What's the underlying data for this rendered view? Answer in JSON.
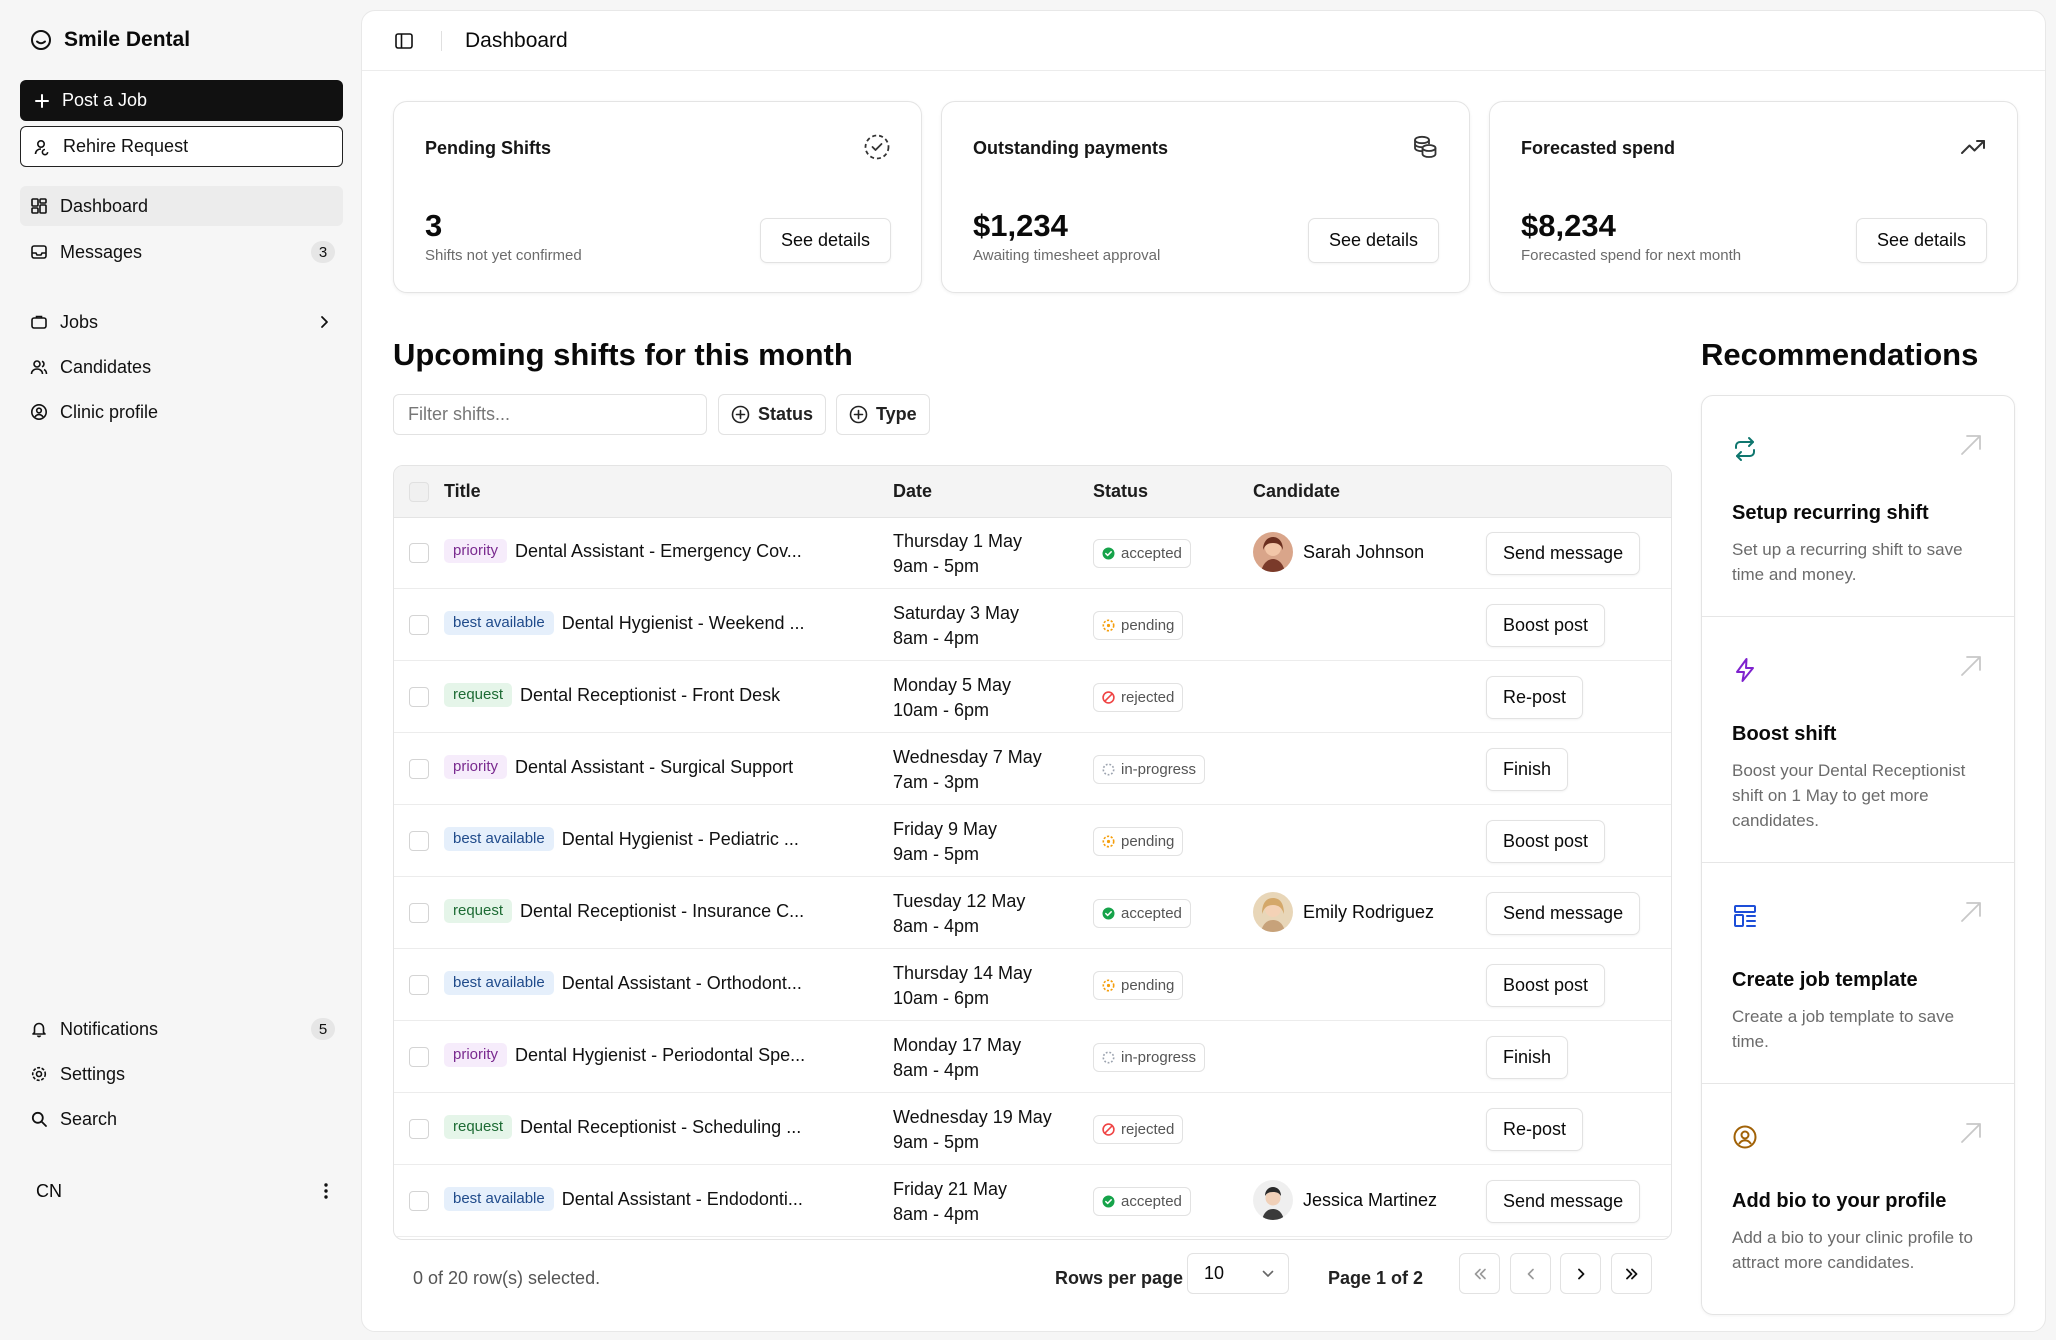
{
  "sidebar": {
    "brand": "Smile Dental",
    "post_job": "Post a Job",
    "rehire": "Rehire Request",
    "nav": [
      {
        "label": "Dashboard",
        "icon": "dashboard-icon"
      },
      {
        "label": "Messages",
        "icon": "inbox-icon",
        "count": "3"
      },
      {
        "label": "Jobs",
        "icon": "briefcase-icon"
      },
      {
        "label": "Candidates",
        "icon": "users-icon"
      },
      {
        "label": "Clinic profile",
        "icon": "user-circle-icon"
      }
    ],
    "bottom_nav": [
      {
        "label": "Notifications",
        "icon": "bell-icon",
        "count": "5"
      },
      {
        "label": "Settings",
        "icon": "gear-icon"
      },
      {
        "label": "Search",
        "icon": "search-icon"
      }
    ],
    "user_initials": "CN"
  },
  "header": {
    "title": "Dashboard"
  },
  "cards": [
    {
      "title": "Pending Shifts",
      "value": "3",
      "sub": "Shifts not yet confirmed",
      "button": "See details",
      "icon": "dashed-check-circle-icon"
    },
    {
      "title": "Outstanding payments",
      "value": "$1,234",
      "sub": "Awaiting timesheet approval",
      "button": "See details",
      "icon": "coins-icon"
    },
    {
      "title": "Forecasted spend",
      "value": "$8,234",
      "sub": "Forecasted spend for next month",
      "button": "See details",
      "icon": "trending-up-icon"
    }
  ],
  "shifts": {
    "heading": "Upcoming shifts for this month",
    "filter_placeholder": "Filter shifts...",
    "status_filter": "Status",
    "type_filter": "Type",
    "columns": [
      "Title",
      "Date",
      "Status",
      "Candidate"
    ],
    "rows": [
      {
        "tag": "priority",
        "title": "Dental Assistant - Emergency Cov...",
        "date": "Thursday 1 May",
        "time": "9am - 5pm",
        "status": "accepted",
        "candidate": "Sarah Johnson",
        "action": "Send message"
      },
      {
        "tag": "best available",
        "title": "Dental Hygienist - Weekend ...",
        "date": "Saturday 3 May",
        "time": "8am - 4pm",
        "status": "pending",
        "candidate": "",
        "action": "Boost post"
      },
      {
        "tag": "request",
        "title": "Dental Receptionist - Front Desk",
        "date": "Monday 5 May",
        "time": "10am - 6pm",
        "status": "rejected",
        "candidate": "",
        "action": "Re-post"
      },
      {
        "tag": "priority",
        "title": "Dental Assistant - Surgical Support",
        "date": "Wednesday 7 May",
        "time": "7am - 3pm",
        "status": "in-progress",
        "candidate": "",
        "action": "Finish"
      },
      {
        "tag": "best available",
        "title": "Dental Hygienist - Pediatric ...",
        "date": "Friday 9 May",
        "time": "9am - 5pm",
        "status": "pending",
        "candidate": "",
        "action": "Boost post"
      },
      {
        "tag": "request",
        "title": "Dental Receptionist - Insurance C...",
        "date": "Tuesday 12 May",
        "time": "8am - 4pm",
        "status": "accepted",
        "candidate": "Emily Rodriguez",
        "action": "Send message"
      },
      {
        "tag": "best available",
        "title": "Dental Assistant - Orthodont...",
        "date": "Thursday 14 May",
        "time": "10am - 6pm",
        "status": "pending",
        "candidate": "",
        "action": "Boost post"
      },
      {
        "tag": "priority",
        "title": "Dental Hygienist - Periodontal Spe...",
        "date": "Monday 17 May",
        "time": "8am - 4pm",
        "status": "in-progress",
        "candidate": "",
        "action": "Finish"
      },
      {
        "tag": "request",
        "title": "Dental Receptionist - Scheduling ...",
        "date": "Wednesday 19 May",
        "time": "9am - 5pm",
        "status": "rejected",
        "candidate": "",
        "action": "Re-post"
      },
      {
        "tag": "best available",
        "title": "Dental Assistant - Endodonti...",
        "date": "Friday 21 May",
        "time": "8am - 4pm",
        "status": "accepted",
        "candidate": "Jessica Martinez",
        "action": "Send message"
      }
    ],
    "selection": "0 of 20 row(s) selected.",
    "rows_per_page_label": "Rows per page",
    "rows_per_page": "10",
    "page_label": "Page 1 of 2"
  },
  "recommendations": {
    "heading": "Recommendations",
    "items": [
      {
        "title": "Setup recurring shift",
        "desc": "Set up a recurring shift to save time and money.",
        "icon": "repeat-icon",
        "color": "#0f766e"
      },
      {
        "title": "Boost shift",
        "desc": "Boost your Dental Receptionist shift on 1 May to get more candidates.",
        "icon": "lightning-icon",
        "color": "#7e22ce"
      },
      {
        "title": "Create job template",
        "desc": "Create a job template to save time.",
        "icon": "template-icon",
        "color": "#1d4ed8"
      },
      {
        "title": "Add bio to your profile",
        "desc": "Add a bio to your clinic profile to attract more candidates.",
        "icon": "user-circle-icon",
        "color": "#a16207"
      }
    ]
  },
  "colors": {
    "primary": "#111111",
    "accepted": "#16a34a",
    "pending": "#f59e0b",
    "rejected": "#ef4444",
    "in_progress": "#9ca3af"
  }
}
